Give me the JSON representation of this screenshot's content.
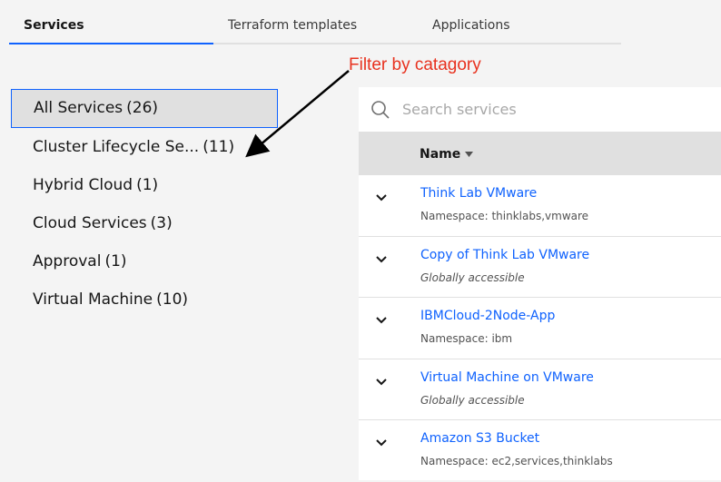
{
  "tabs": [
    {
      "label": "Services",
      "active": true
    },
    {
      "label": "Terraform templates",
      "active": false
    },
    {
      "label": "Applications",
      "active": false
    }
  ],
  "annotation": {
    "text": "Filter by catagory",
    "color": "#e8321f"
  },
  "sidebar": {
    "items": [
      {
        "label": "All Services",
        "count": "(26)",
        "selected": true
      },
      {
        "label": "Cluster Lifecycle Se...",
        "count": "(11)"
      },
      {
        "label": "Hybrid Cloud",
        "count": "(1)"
      },
      {
        "label": "Cloud Services",
        "count": "(3)"
      },
      {
        "label": "Approval",
        "count": "(1)"
      },
      {
        "label": "Virtual Machine",
        "count": "(10)"
      }
    ]
  },
  "search": {
    "placeholder": "Search services",
    "value": ""
  },
  "table": {
    "column_name": "Name",
    "rows": [
      {
        "title": "Think Lab VMware",
        "sub": "Namespace: thinklabs,vmware"
      },
      {
        "title": "Copy of Think Lab VMware",
        "sub": "Globally accessible"
      },
      {
        "title": "IBMCloud-2Node-App",
        "sub": "Namespace: ibm"
      },
      {
        "title": "Virtual Machine on VMware",
        "sub": "Globally accessible"
      },
      {
        "title": "Amazon S3 Bucket",
        "sub": "Namespace: ec2,services,thinklabs"
      }
    ]
  },
  "colors": {
    "accent": "#0f62fe",
    "annotation": "#e8321f"
  },
  "icons": {
    "search": "search-icon",
    "expand": "chevron-down-icon",
    "sort": "sort-down-icon"
  }
}
